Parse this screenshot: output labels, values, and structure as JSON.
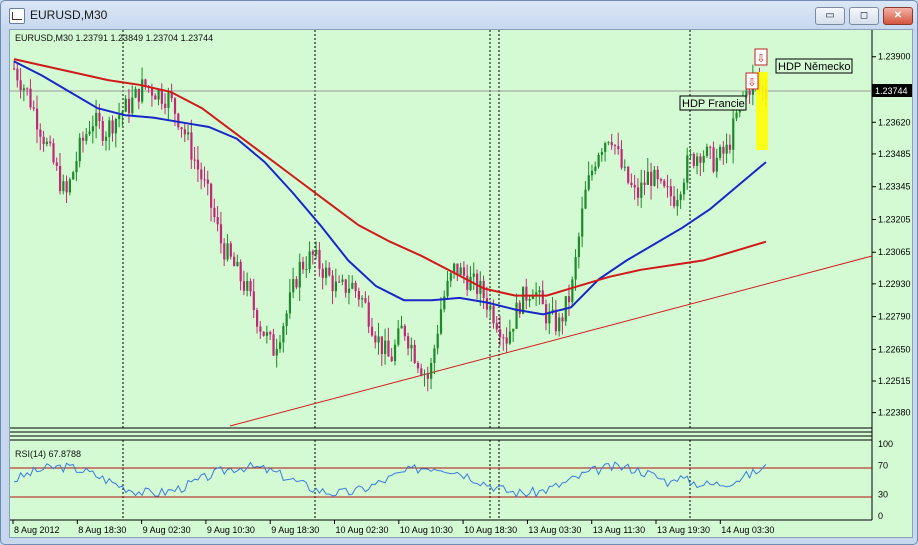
{
  "window": {
    "title": "EURUSD,M30",
    "buttons": {
      "minimize": "▭",
      "restore": "◻",
      "close": "✕"
    }
  },
  "chart": {
    "header": "EURUSD,M30  1.23791 1.23849 1.23704 1.23744",
    "current_price": "1.23744",
    "price_ticks": [
      "1.23900",
      "1.23760",
      "1.23620",
      "1.23485",
      "1.23345",
      "1.23205",
      "1.23065",
      "1.22930",
      "1.22790",
      "1.22650",
      "1.22515",
      "1.22380"
    ],
    "annotations": {
      "label1": "HDP Francie",
      "label2": "HDP Německo"
    },
    "time_labels": [
      "8 Aug 2012",
      "8 Aug 18:30",
      "9 Aug 02:30",
      "9 Aug 10:30",
      "9 Aug 18:30",
      "10 Aug 02:30",
      "10 Aug 10:30",
      "10 Aug 18:30",
      "13 Aug 03:30",
      "13 Aug 11:30",
      "13 Aug 19:30",
      "14 Aug 03:30"
    ],
    "rsi": {
      "label": "RSI(14) 67.8788",
      "ticks": [
        "100",
        "70",
        "30",
        "0"
      ]
    }
  },
  "colors": {
    "background": "#d4fad3",
    "bull": "#1c8a2a",
    "bear": "#c2287a",
    "ma_fast": "#1a27c8",
    "ma_slow": "#d01a1a",
    "trendline": "#d01a1a",
    "rsi": "#3a7be0",
    "highlight": "#ffff00"
  },
  "chart_data": {
    "type": "candlestick",
    "symbol": "EURUSD",
    "timeframe": "M30",
    "ohlc_last": {
      "open": 1.23791,
      "high": 1.23849,
      "low": 1.23704,
      "close": 1.23744
    },
    "close_path": [
      1.2385,
      1.2375,
      1.236,
      1.2345,
      1.233,
      1.235,
      1.2363,
      1.2358,
      1.2365,
      1.237,
      1.2378,
      1.2375,
      1.2372,
      1.236,
      1.2345,
      1.233,
      1.231,
      1.23,
      1.229,
      1.2275,
      1.2265,
      1.228,
      1.23,
      1.2305,
      1.2298,
      1.229,
      1.2293,
      1.2285,
      1.227,
      1.226,
      1.2275,
      1.2262,
      1.2252,
      1.2285,
      1.23,
      1.2295,
      1.229,
      1.228,
      1.227,
      1.2285,
      1.2292,
      1.228,
      1.2275,
      1.229,
      1.233,
      1.235,
      1.2358,
      1.234,
      1.233,
      1.234,
      1.2332,
      1.233,
      1.2345,
      1.235,
      1.2345,
      1.235,
      1.237,
      1.238,
      1.2374
    ],
    "ma_fast": [
      1.2388,
      1.2382,
      1.2375,
      1.2368,
      1.2365,
      1.2364,
      1.2362,
      1.236,
      1.2355,
      1.2345,
      1.2332,
      1.2318,
      1.2303,
      1.2292,
      1.2286,
      1.2286,
      1.2287,
      1.2285,
      1.2282,
      1.228,
      1.2283,
      1.2295,
      1.2303,
      1.231,
      1.2317,
      1.2325,
      1.2335,
      1.2345
    ],
    "ma_slow": [
      1.2389,
      1.2386,
      1.2383,
      1.238,
      1.2378,
      1.2375,
      1.2368,
      1.2358,
      1.2348,
      1.2338,
      1.2328,
      1.2318,
      1.2311,
      1.2305,
      1.2298,
      1.2291,
      1.2288,
      1.2288,
      1.2292,
      1.2296,
      1.2299,
      1.2301,
      1.2303,
      1.2307,
      1.2311
    ],
    "ylim": [
      1.2234,
      1.2398
    ],
    "rsi_value": 67.8788,
    "rsi_levels": [
      70,
      30
    ]
  }
}
